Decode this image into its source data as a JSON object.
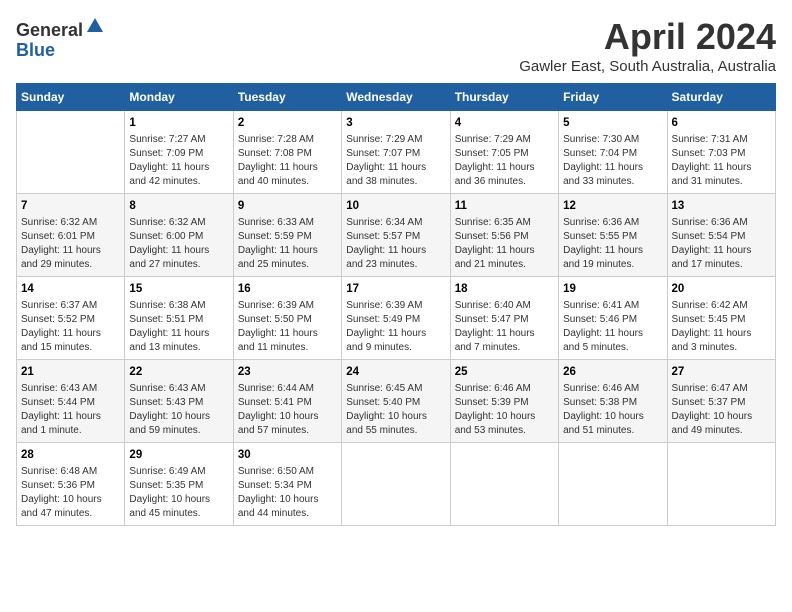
{
  "header": {
    "logo_line1": "General",
    "logo_line2": "Blue",
    "title": "April 2024",
    "subtitle": "Gawler East, South Australia, Australia"
  },
  "columns": [
    "Sunday",
    "Monday",
    "Tuesday",
    "Wednesday",
    "Thursday",
    "Friday",
    "Saturday"
  ],
  "weeks": [
    [
      {
        "day": "",
        "info": ""
      },
      {
        "day": "1",
        "info": "Sunrise: 7:27 AM\nSunset: 7:09 PM\nDaylight: 11 hours\nand 42 minutes."
      },
      {
        "day": "2",
        "info": "Sunrise: 7:28 AM\nSunset: 7:08 PM\nDaylight: 11 hours\nand 40 minutes."
      },
      {
        "day": "3",
        "info": "Sunrise: 7:29 AM\nSunset: 7:07 PM\nDaylight: 11 hours\nand 38 minutes."
      },
      {
        "day": "4",
        "info": "Sunrise: 7:29 AM\nSunset: 7:05 PM\nDaylight: 11 hours\nand 36 minutes."
      },
      {
        "day": "5",
        "info": "Sunrise: 7:30 AM\nSunset: 7:04 PM\nDaylight: 11 hours\nand 33 minutes."
      },
      {
        "day": "6",
        "info": "Sunrise: 7:31 AM\nSunset: 7:03 PM\nDaylight: 11 hours\nand 31 minutes."
      }
    ],
    [
      {
        "day": "7",
        "info": "Sunrise: 6:32 AM\nSunset: 6:01 PM\nDaylight: 11 hours\nand 29 minutes."
      },
      {
        "day": "8",
        "info": "Sunrise: 6:32 AM\nSunset: 6:00 PM\nDaylight: 11 hours\nand 27 minutes."
      },
      {
        "day": "9",
        "info": "Sunrise: 6:33 AM\nSunset: 5:59 PM\nDaylight: 11 hours\nand 25 minutes."
      },
      {
        "day": "10",
        "info": "Sunrise: 6:34 AM\nSunset: 5:57 PM\nDaylight: 11 hours\nand 23 minutes."
      },
      {
        "day": "11",
        "info": "Sunrise: 6:35 AM\nSunset: 5:56 PM\nDaylight: 11 hours\nand 21 minutes."
      },
      {
        "day": "12",
        "info": "Sunrise: 6:36 AM\nSunset: 5:55 PM\nDaylight: 11 hours\nand 19 minutes."
      },
      {
        "day": "13",
        "info": "Sunrise: 6:36 AM\nSunset: 5:54 PM\nDaylight: 11 hours\nand 17 minutes."
      }
    ],
    [
      {
        "day": "14",
        "info": "Sunrise: 6:37 AM\nSunset: 5:52 PM\nDaylight: 11 hours\nand 15 minutes."
      },
      {
        "day": "15",
        "info": "Sunrise: 6:38 AM\nSunset: 5:51 PM\nDaylight: 11 hours\nand 13 minutes."
      },
      {
        "day": "16",
        "info": "Sunrise: 6:39 AM\nSunset: 5:50 PM\nDaylight: 11 hours\nand 11 minutes."
      },
      {
        "day": "17",
        "info": "Sunrise: 6:39 AM\nSunset: 5:49 PM\nDaylight: 11 hours\nand 9 minutes."
      },
      {
        "day": "18",
        "info": "Sunrise: 6:40 AM\nSunset: 5:47 PM\nDaylight: 11 hours\nand 7 minutes."
      },
      {
        "day": "19",
        "info": "Sunrise: 6:41 AM\nSunset: 5:46 PM\nDaylight: 11 hours\nand 5 minutes."
      },
      {
        "day": "20",
        "info": "Sunrise: 6:42 AM\nSunset: 5:45 PM\nDaylight: 11 hours\nand 3 minutes."
      }
    ],
    [
      {
        "day": "21",
        "info": "Sunrise: 6:43 AM\nSunset: 5:44 PM\nDaylight: 11 hours\nand 1 minute."
      },
      {
        "day": "22",
        "info": "Sunrise: 6:43 AM\nSunset: 5:43 PM\nDaylight: 10 hours\nand 59 minutes."
      },
      {
        "day": "23",
        "info": "Sunrise: 6:44 AM\nSunset: 5:41 PM\nDaylight: 10 hours\nand 57 minutes."
      },
      {
        "day": "24",
        "info": "Sunrise: 6:45 AM\nSunset: 5:40 PM\nDaylight: 10 hours\nand 55 minutes."
      },
      {
        "day": "25",
        "info": "Sunrise: 6:46 AM\nSunset: 5:39 PM\nDaylight: 10 hours\nand 53 minutes."
      },
      {
        "day": "26",
        "info": "Sunrise: 6:46 AM\nSunset: 5:38 PM\nDaylight: 10 hours\nand 51 minutes."
      },
      {
        "day": "27",
        "info": "Sunrise: 6:47 AM\nSunset: 5:37 PM\nDaylight: 10 hours\nand 49 minutes."
      }
    ],
    [
      {
        "day": "28",
        "info": "Sunrise: 6:48 AM\nSunset: 5:36 PM\nDaylight: 10 hours\nand 47 minutes."
      },
      {
        "day": "29",
        "info": "Sunrise: 6:49 AM\nSunset: 5:35 PM\nDaylight: 10 hours\nand 45 minutes."
      },
      {
        "day": "30",
        "info": "Sunrise: 6:50 AM\nSunset: 5:34 PM\nDaylight: 10 hours\nand 44 minutes."
      },
      {
        "day": "",
        "info": ""
      },
      {
        "day": "",
        "info": ""
      },
      {
        "day": "",
        "info": ""
      },
      {
        "day": "",
        "info": ""
      }
    ]
  ]
}
